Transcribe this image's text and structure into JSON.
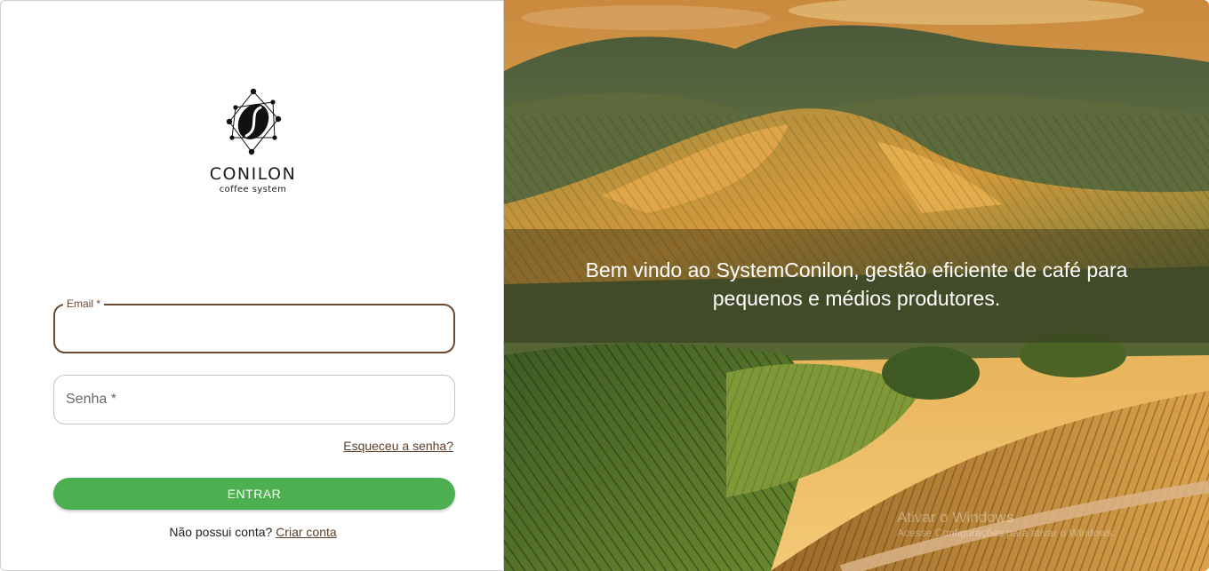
{
  "logo": {
    "name": "CONILON",
    "subtitle": "coffee system"
  },
  "login_form": {
    "email_label": "Email *",
    "email_value": "",
    "password_label": "Senha *",
    "password_value": "",
    "forgot_password": "Esqueceu a senha?",
    "submit_label": "ENTRAR",
    "no_account_text": "Não possui conta?",
    "create_account_link": "Criar conta"
  },
  "hero": {
    "welcome_line1": "Bem vindo ao SystemConilon, gestão eficiente de café para",
    "welcome_line2": "pequenos e médios produtores."
  },
  "windows_watermark": {
    "line1": "Ativar o Windows",
    "line2": "Acesse Configurações para ativar o Windows."
  },
  "colors": {
    "accent_brown": "#6b4a33",
    "button_green": "#4caf50",
    "background": "#ffffff"
  }
}
